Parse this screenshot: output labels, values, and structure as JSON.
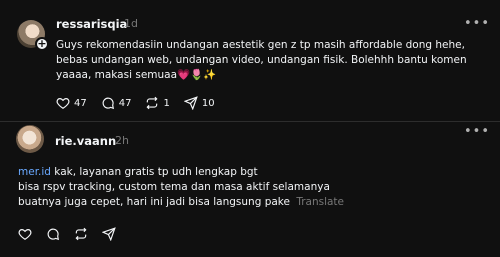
{
  "post1": {
    "username": "ressarisqia",
    "time": "1d",
    "body": "Guys rekomendasiin undangan aestetik gen z tp masih affordable dong hehe, bebas undangan web, undangan video, undangan fisik. Bolehhh bantu komen yaaaa, makasi semuaa💗🌷✨",
    "likes": "47",
    "comments": "47",
    "reposts": "1",
    "shares": "10"
  },
  "post2": {
    "username": "rie.vaann",
    "time": "2h",
    "mention": "mer.id",
    "line1": " kak, layanan gratis tp udh lengkap bgt",
    "line2": "bisa rspv tracking, custom tema dan masa aktif selamanya",
    "line3": "buatnya juga cepet, hari ini jadi bisa langsung pake",
    "translate": "Translate"
  },
  "icons": {
    "like": "heart-icon",
    "comment": "comment-icon",
    "repost": "repost-icon",
    "share": "share-icon",
    "more": "more-icon",
    "follow": "plus-icon"
  },
  "colors": {
    "background": "#101010",
    "text": "#f3f5f7",
    "muted": "#777777",
    "mention": "#6aa9ff"
  }
}
